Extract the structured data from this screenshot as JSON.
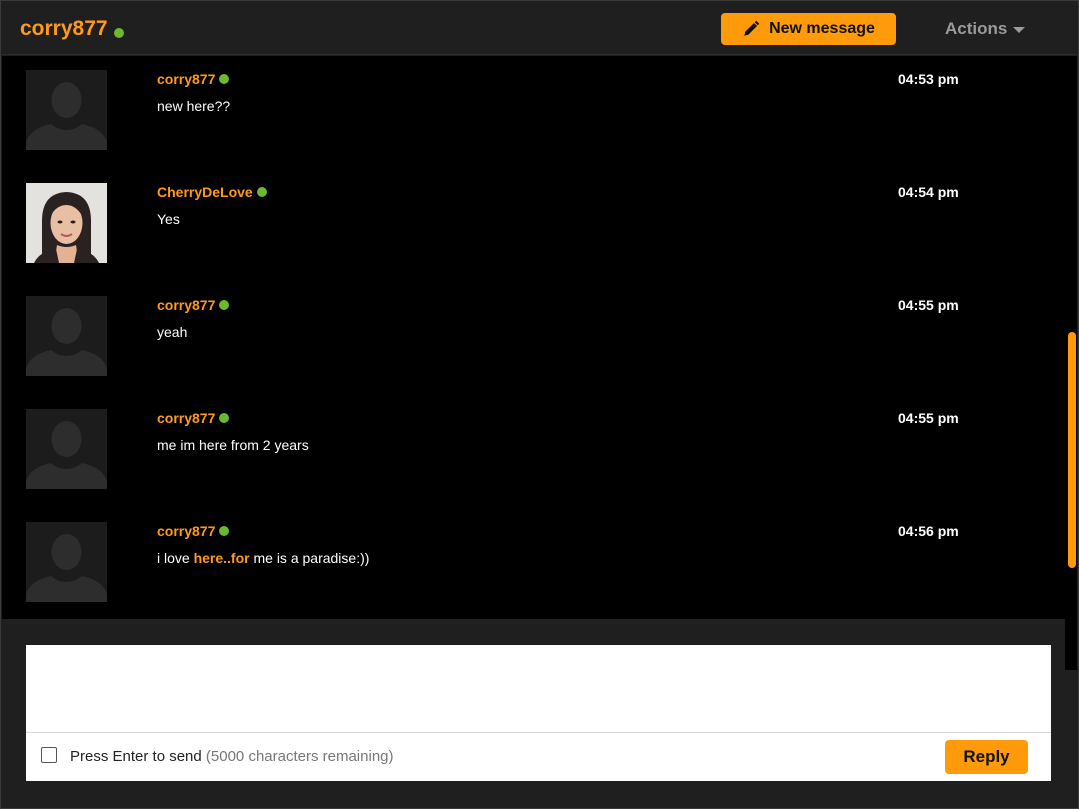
{
  "header": {
    "username": "corry877",
    "new_message_label": "New message",
    "actions_label": "Actions"
  },
  "messages": [
    {
      "author": "corry877",
      "time": "04:53 pm",
      "text": "new here??",
      "avatar": "default-silhouette"
    },
    {
      "author": "CherryDeLove",
      "time": "04:54 pm",
      "text": "Yes",
      "avatar": "profile-photo"
    },
    {
      "author": "corry877",
      "time": "04:55 pm",
      "text": "yeah",
      "avatar": "default-silhouette"
    },
    {
      "author": "corry877",
      "time": "04:55 pm",
      "text": "me im here from 2 years",
      "avatar": "default-silhouette"
    },
    {
      "author": "corry877",
      "time": "04:56 pm",
      "text_before": "i love ",
      "text_link": "here..for",
      "text_after": " me is a paradise:))",
      "avatar": "default-silhouette"
    }
  ],
  "composer": {
    "value": "",
    "enter_to_send_label": "Press Enter to send",
    "remaining_label": "(5000 characters remaining)",
    "reply_label": "Reply"
  },
  "colors": {
    "accent": "#ff9a0a",
    "username": "#ff9a1f",
    "online": "#6cb82e",
    "background": "#000000",
    "header": "#1f1f1f"
  },
  "icons": {
    "compose": "pencil-icon",
    "dropdown": "caret-down-icon",
    "status": "online-dot-icon"
  }
}
